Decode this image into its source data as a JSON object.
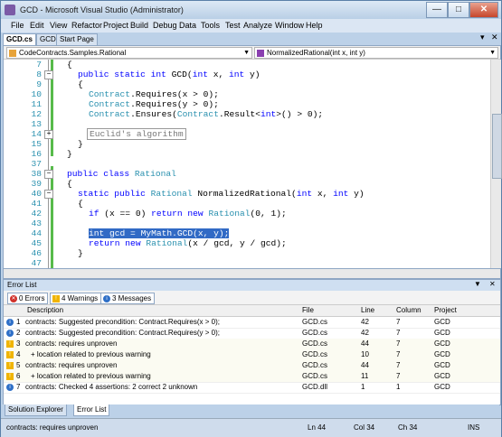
{
  "window": {
    "title": "GCD - Microsoft Visual Studio (Administrator)"
  },
  "menu": [
    "File",
    "Edit",
    "View",
    "Refactor",
    "Project",
    "Build",
    "Debug",
    "Data",
    "Tools",
    "Test",
    "Analyze",
    "Window",
    "Help"
  ],
  "tabs": [
    "GCD.cs",
    "GCD",
    "Start Page"
  ],
  "editor": {
    "type_combo": "CodeContracts.Samples.Rational",
    "member_combo": "NormalizedRational(int x, int y)"
  },
  "code": {
    "line_numbers": [
      "7",
      "8",
      "9",
      "10",
      "11",
      "12",
      "13",
      "14",
      "15",
      "16",
      "37",
      "38",
      "39",
      "40",
      "41",
      "42",
      "43",
      "44",
      "45",
      "46",
      "47"
    ],
    "l7": "{",
    "l8": [
      "public static int ",
      "GCD",
      "(",
      "int",
      " x, ",
      "int",
      " y)"
    ],
    "l9": "{",
    "l10": [
      "Contract",
      ".Requires(x > 0);"
    ],
    "l11": [
      "Contract",
      ".Requires(y > 0);"
    ],
    "l12": [
      "Contract",
      ".Ensures(",
      "Contract",
      ".Result<",
      "int",
      ">() > 0);"
    ],
    "l14": "Euclid's algorithm",
    "l15": "}",
    "l16": "}",
    "l38": [
      "public class ",
      "Rational"
    ],
    "l39": "{",
    "l40": [
      "static public ",
      "Rational",
      " NormalizedRational(",
      "int",
      " x, ",
      "int",
      " y)"
    ],
    "l41": "{",
    "l42": [
      "if",
      " (x == 0) ",
      "return new ",
      "Rational",
      "(0, 1);"
    ],
    "l44": "int gcd = MyMath.GCD(x, y);",
    "l45": [
      "return new ",
      "Rational",
      "(x / gcd, y / gcd);"
    ],
    "l46": "}"
  },
  "error_list": {
    "title": "Error List",
    "filters": {
      "errors": "0 Errors",
      "warnings": "4 Warnings",
      "messages": "3 Messages"
    },
    "columns": [
      "Description",
      "File",
      "Line",
      "Column",
      "Project"
    ],
    "rows": [
      {
        "num": "1",
        "kind": "info",
        "desc": "contracts: Suggested precondition: Contract.Requires(x > 0);",
        "file": "GCD.cs",
        "line": "42",
        "col": "7",
        "project": "GCD"
      },
      {
        "num": "2",
        "kind": "info",
        "desc": "contracts: Suggested precondition: Contract.Requires(y > 0);",
        "file": "GCD.cs",
        "line": "42",
        "col": "7",
        "project": "GCD"
      },
      {
        "num": "3",
        "kind": "warning",
        "desc": "contracts: requires unproven",
        "file": "GCD.cs",
        "line": "44",
        "col": "7",
        "project": "GCD"
      },
      {
        "num": "4",
        "kind": "warning",
        "desc": "+ location related to previous warning",
        "file": "GCD.cs",
        "line": "10",
        "col": "7",
        "project": "GCD"
      },
      {
        "num": "5",
        "kind": "warning",
        "desc": "contracts: requires unproven",
        "file": "GCD.cs",
        "line": "44",
        "col": "7",
        "project": "GCD"
      },
      {
        "num": "6",
        "kind": "warning",
        "desc": "+ location related to previous warning",
        "file": "GCD.cs",
        "line": "11",
        "col": "7",
        "project": "GCD"
      },
      {
        "num": "7",
        "kind": "info",
        "desc": "contracts: Checked 4 assertions: 2 correct 2 unknown",
        "file": "GCD.dll",
        "line": "1",
        "col": "1",
        "project": "GCD"
      }
    ]
  },
  "bottom_tabs": [
    "Solution Explorer",
    "Error List"
  ],
  "status": {
    "message": "contracts: requires unproven",
    "ln": "Ln 44",
    "col": "Col 34",
    "ch": "Ch 34",
    "mode": "INS"
  },
  "colors": {
    "keyword": "#0000ff",
    "type": "#2b91af",
    "selection": "#316ac5",
    "warning": "#f0b400",
    "info": "#2e6fc7",
    "error": "#d0302a"
  }
}
